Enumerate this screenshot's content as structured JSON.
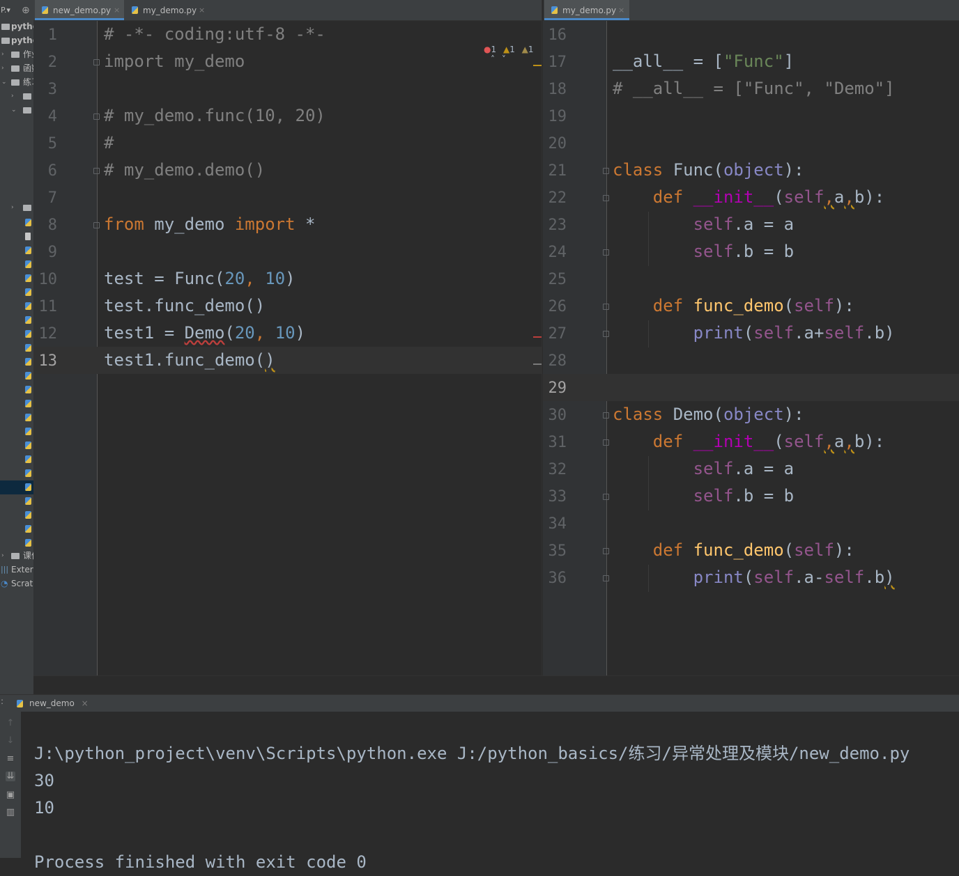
{
  "tree": {
    "items": [
      {
        "label": "P.▾"
      },
      {
        "label": "pytho"
      },
      {
        "label": "pytho"
      },
      {
        "label": "作业"
      },
      {
        "label": "函数"
      },
      {
        "label": "练习"
      },
      {
        "label": "课件"
      },
      {
        "label": "Extern"
      },
      {
        "label": "Scratc"
      }
    ]
  },
  "left_tabs": [
    {
      "label": "new_demo.py",
      "active": true
    },
    {
      "label": "my_demo.py",
      "active": false
    }
  ],
  "right_tabs": [
    {
      "label": "my_demo.py",
      "active": true
    }
  ],
  "inspections": {
    "errors": "1",
    "warnings": "1",
    "weak_warnings": "1"
  },
  "left_editor": {
    "line_numbers": [
      "1",
      "2",
      "3",
      "4",
      "5",
      "6",
      "7",
      "8",
      "9",
      "10",
      "11",
      "12",
      "13"
    ],
    "current_line": "13"
  },
  "right_editor": {
    "line_numbers": [
      "16",
      "17",
      "18",
      "19",
      "20",
      "21",
      "22",
      "23",
      "24",
      "25",
      "26",
      "27",
      "28",
      "29",
      "30",
      "31",
      "32",
      "33",
      "34",
      "35",
      "36"
    ],
    "current_line": "29"
  },
  "run": {
    "tab_label": "new_demo",
    "output": [
      "J:\\python_project\\venv\\Scripts\\python.exe J:/python_basics/练习/异常处理及模块/new_demo.py",
      "30",
      "10",
      "",
      "Process finished with exit code 0"
    ]
  },
  "colors": {
    "background": "#2b2b2b",
    "keyword": "#cc7832",
    "comment": "#808080",
    "number": "#6897bb",
    "string": "#6a8759",
    "self": "#94558d",
    "function": "#ffc66d",
    "magic": "#b200b2"
  }
}
